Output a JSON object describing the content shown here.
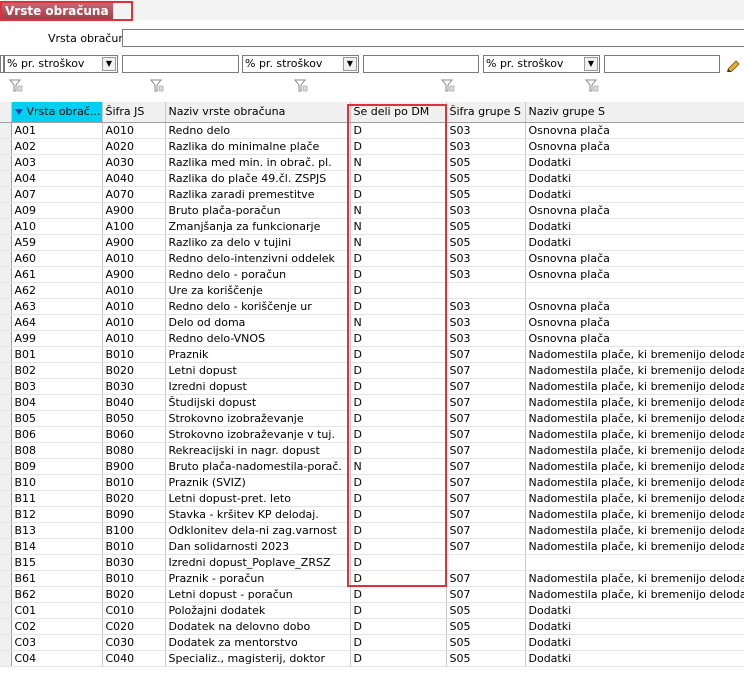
{
  "window": {
    "title": "Vrste obračuna"
  },
  "filter": {
    "label": "Vrsta obračuna",
    "value": ""
  },
  "combos": [
    {
      "value": "% pr. stroškov"
    },
    {
      "value": "% pr. stroškov"
    },
    {
      "value": "% pr. stroškov"
    }
  ],
  "icons": {
    "funnel": "filter-funnel-icon",
    "edit": "pencil-edit-icon",
    "sort": "sort-descending-icon"
  },
  "colors": {
    "sorted_header": "#00d0ef",
    "highlight": "#e0303a",
    "title_tab": "#9e3b46"
  },
  "columns": [
    "Vrsta obrač...",
    "Šifra JS",
    "Naziv vrste obračuna",
    "Se deli po DM",
    "Šifra grupe S",
    "Naziv grupe S"
  ],
  "rows": [
    [
      "A01",
      "A010",
      "Redno delo",
      "D",
      "S03",
      "Osnovna plača"
    ],
    [
      "A02",
      "A020",
      "Razlika do minimalne plače",
      "D",
      "S03",
      "Osnovna plača"
    ],
    [
      "A03",
      "A030",
      "Razlika med min. in obrač. pl.",
      "N",
      "S05",
      "Dodatki"
    ],
    [
      "A04",
      "A040",
      "Razlika do plače 49.čl. ZSPJS",
      "D",
      "S05",
      "Dodatki"
    ],
    [
      "A07",
      "A070",
      "Razlika zaradi premestitve",
      "D",
      "S05",
      "Dodatki"
    ],
    [
      "A09",
      "A900",
      "Bruto plača-poračun",
      "N",
      "S03",
      "Osnovna plača"
    ],
    [
      "A10",
      "A100",
      "Zmanjšanja za funkcionarje",
      "N",
      "S05",
      "Dodatki"
    ],
    [
      "A59",
      "A900",
      "Razliko za delo v tujini",
      "N",
      "S05",
      "Dodatki"
    ],
    [
      "A60",
      "A010",
      "Redno delo-intenzivni oddelek",
      "D",
      "S03",
      "Osnovna plača"
    ],
    [
      "A61",
      "A900",
      "Redno delo  - poračun",
      "D",
      "S03",
      "Osnovna plača"
    ],
    [
      "A62",
      "A010",
      "Ure za koriščenje",
      "D",
      "",
      ""
    ],
    [
      "A63",
      "A010",
      "Redno delo - koriščenje ur",
      "D",
      "S03",
      "Osnovna plača"
    ],
    [
      "A64",
      "A010",
      "Delo od doma",
      "N",
      "S03",
      "Osnovna plača"
    ],
    [
      "A99",
      "A010",
      "Redno delo-VNOS",
      "D",
      "S03",
      "Osnovna plača"
    ],
    [
      "B01",
      "B010",
      "Praznik",
      "D",
      "S07",
      "Nadomestila plače, ki bremenijo delodajalca"
    ],
    [
      "B02",
      "B020",
      "Letni dopust",
      "D",
      "S07",
      "Nadomestila plače, ki bremenijo delodajalca"
    ],
    [
      "B03",
      "B030",
      "Izredni dopust",
      "D",
      "S07",
      "Nadomestila plače, ki bremenijo delodajalca"
    ],
    [
      "B04",
      "B040",
      "Študijski dopust",
      "D",
      "S07",
      "Nadomestila plače, ki bremenijo delodajalca"
    ],
    [
      "B05",
      "B050",
      "Strokovno izobraževanje",
      "D",
      "S07",
      "Nadomestila plače, ki bremenijo delodajalca"
    ],
    [
      "B06",
      "B060",
      "Strokovno izobraževanje v tuj.",
      "D",
      "S07",
      "Nadomestila plače, ki bremenijo delodajalca"
    ],
    [
      "B08",
      "B080",
      "Rekreacijski in nagr. dopust",
      "D",
      "S07",
      "Nadomestila plače, ki bremenijo delodajalca"
    ],
    [
      "B09",
      "B900",
      "Bruto plača-nadomestila-porač.",
      "N",
      "S07",
      "Nadomestila plače, ki bremenijo delodajalca"
    ],
    [
      "B10",
      "B010",
      "Praznik (SVIZ)",
      "D",
      "S07",
      "Nadomestila plače, ki bremenijo delodajalca"
    ],
    [
      "B11",
      "B020",
      "Letni dopust-pret. leto",
      "D",
      "S07",
      "Nadomestila plače, ki bremenijo delodajalca"
    ],
    [
      "B12",
      "B090",
      "Stavka - kršitev KP delodaj.",
      "D",
      "S07",
      "Nadomestila plače, ki bremenijo delodajalca"
    ],
    [
      "B13",
      "B100",
      "Odklonitev dela-ni zag.varnost",
      "D",
      "S07",
      "Nadomestila plače, ki bremenijo delodajalca"
    ],
    [
      "B14",
      "B010",
      "Dan solidarnosti 2023",
      "D",
      "S07",
      "Nadomestila plače, ki bremenijo delodajalca"
    ],
    [
      "B15",
      "B030",
      "Izredni dopust_Poplave_ZRSZ",
      "D",
      "",
      ""
    ],
    [
      "B61",
      "B010",
      "Praznik - poračun",
      "D",
      "S07",
      "Nadomestila plače, ki bremenijo delodajalca"
    ],
    [
      "B62",
      "B020",
      "Letni dopust - poračun",
      "D",
      "S07",
      "Nadomestila plače, ki bremenijo delodajalca"
    ],
    [
      "C01",
      "C010",
      "Položajni dodatek",
      "D",
      "S05",
      "Dodatki"
    ],
    [
      "C02",
      "C020",
      "Dodatek na delovno dobo",
      "D",
      "S05",
      "Dodatki"
    ],
    [
      "C03",
      "C030",
      "Dodatek za mentorstvo",
      "D",
      "S05",
      "Dodatki"
    ],
    [
      "C04",
      "C040",
      "Specializ., magisterij, doktor",
      "D",
      "S05",
      "Dodatki"
    ]
  ]
}
